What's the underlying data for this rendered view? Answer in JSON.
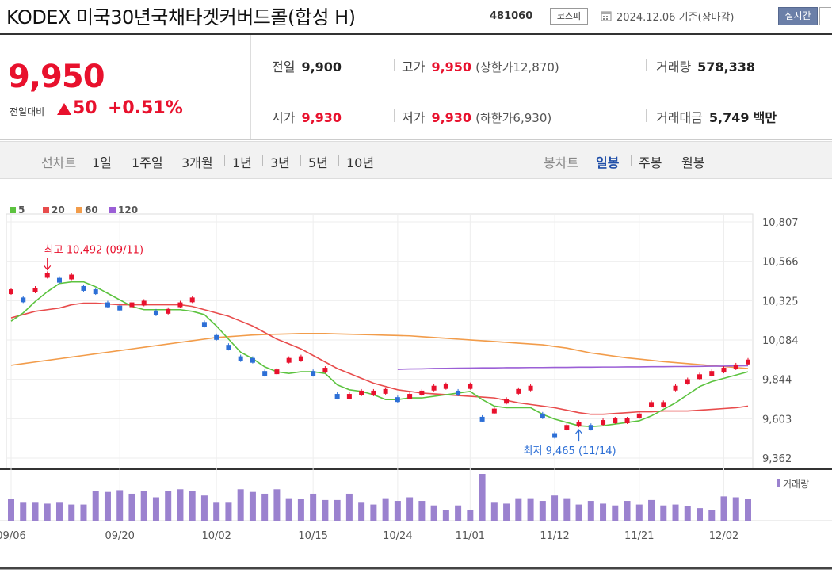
{
  "header": {
    "stock_name": "KODEX 미국30년국채타겟커버드콜(합성 H)",
    "stock_code": "481060",
    "market": "코스피",
    "date_label": "2024.12.06 기준(장마감)",
    "realtime_label": "실시간"
  },
  "summary": {
    "price": "9,950",
    "change_label": "전일대비",
    "change": "50",
    "change_pct": "+0.51%",
    "prev_close_label": "전일",
    "prev_close": "9,900",
    "open_label": "시가",
    "open": "9,930",
    "high_label": "고가",
    "high": "9,950",
    "upper_limit_label": "(상한가",
    "upper_limit": "12,870)",
    "low_label": "저가",
    "low": "9,930",
    "lower_limit_label": "(하한가",
    "lower_limit": "6,930)",
    "volume_label": "거래량",
    "volume": "578,338",
    "amount_label": "거래대금",
    "amount": "5,749",
    "amount_unit": "백만"
  },
  "periods": {
    "line_label": "선차트",
    "line_items": [
      "1일",
      "1주일",
      "3개월",
      "1년",
      "3년",
      "5년",
      "10년"
    ],
    "candle_label": "봉차트",
    "candle_items": [
      "일봉",
      "주봉",
      "월봉"
    ],
    "selected": "일봉"
  },
  "colors": {
    "up": "#e8112d",
    "down": "#2d6fd6",
    "ma5": "#5cc33f",
    "ma20": "#e84c4c",
    "ma60": "#f29c4a",
    "ma120": "#9b5fd6",
    "volume": "#9b82cf"
  },
  "chart_data": {
    "type": "candlestick",
    "legend": [
      {
        "name": "5",
        "color": "#5cc33f"
      },
      {
        "name": "20",
        "color": "#e84c4c"
      },
      {
        "name": "60",
        "color": "#f29c4a"
      },
      {
        "name": "120",
        "color": "#9b5fd6"
      }
    ],
    "y_ticks": [
      "10,807",
      "10,566",
      "10,325",
      "10,084",
      "9,844",
      "9,603",
      "9,362"
    ],
    "ylim": [
      9362,
      10807
    ],
    "x_ticks": [
      "09/06",
      "09/20",
      "10/02",
      "10/15",
      "10/24",
      "11/01",
      "11/12",
      "11/21",
      "12/02"
    ],
    "x_tick_index": [
      0,
      9,
      17,
      25,
      32,
      38,
      45,
      52,
      59
    ],
    "high_annotation": "최고 10,492 (09/11)",
    "high_index": 3,
    "low_annotation": "최저 9,465 (11/14)",
    "low_index": 47,
    "volume_label": "거래량",
    "close": [
      10380,
      10330,
      10390,
      10480,
      10450,
      10470,
      10400,
      10380,
      10300,
      10280,
      10300,
      10310,
      10250,
      10260,
      10300,
      10330,
      10180,
      10100,
      10040,
      9970,
      9960,
      9880,
      9890,
      9960,
      9970,
      9880,
      9900,
      9740,
      9740,
      9760,
      9760,
      9770,
      9720,
      9740,
      9760,
      9790,
      9800,
      9760,
      9800,
      9600,
      9650,
      9710,
      9770,
      9790,
      9620,
      9500,
      9550,
      9570,
      9550,
      9580,
      9590,
      9590,
      9620,
      9690,
      9690,
      9790,
      9830,
      9860,
      9880,
      9900,
      9920,
      9950
    ],
    "ma5": [
      10200,
      10250,
      10320,
      10380,
      10430,
      10440,
      10440,
      10410,
      10370,
      10330,
      10290,
      10270,
      10270,
      10270,
      10270,
      10260,
      10240,
      10170,
      10090,
      10010,
      9970,
      9920,
      9890,
      9880,
      9890,
      9890,
      9880,
      9810,
      9780,
      9770,
      9750,
      9720,
      9720,
      9730,
      9730,
      9740,
      9750,
      9760,
      9770,
      9720,
      9680,
      9670,
      9670,
      9670,
      9630,
      9600,
      9580,
      9560,
      9555,
      9560,
      9570,
      9580,
      9590,
      9620,
      9660,
      9700,
      9750,
      9800,
      9830,
      9850,
      9870,
      9890
    ],
    "ma20": [
      10220,
      10240,
      10260,
      10270,
      10280,
      10300,
      10310,
      10310,
      10305,
      10300,
      10300,
      10300,
      10300,
      10300,
      10300,
      10290,
      10270,
      10250,
      10230,
      10200,
      10170,
      10130,
      10090,
      10060,
      10030,
      9990,
      9950,
      9910,
      9880,
      9850,
      9820,
      9800,
      9780,
      9770,
      9760,
      9755,
      9750,
      9745,
      9740,
      9735,
      9730,
      9715,
      9700,
      9690,
      9680,
      9670,
      9655,
      9640,
      9630,
      9630,
      9635,
      9640,
      9645,
      9645,
      9650,
      9650,
      9650,
      9655,
      9660,
      9665,
      9670,
      9680
    ],
    "ma60": [
      9930,
      9940,
      9950,
      9960,
      9970,
      9980,
      9990,
      10000,
      10010,
      10020,
      10030,
      10040,
      10050,
      10060,
      10070,
      10080,
      10090,
      10100,
      10105,
      10110,
      10115,
      10118,
      10120,
      10122,
      10124,
      10124,
      10124,
      10122,
      10120,
      10118,
      10116,
      10114,
      10112,
      10110,
      10105,
      10100,
      10095,
      10090,
      10085,
      10080,
      10075,
      10070,
      10065,
      10060,
      10055,
      10045,
      10035,
      10020,
      10005,
      9995,
      9985,
      9975,
      9968,
      9960,
      9952,
      9946,
      9940,
      9934,
      9928,
      9922,
      9916,
      9910
    ],
    "ma120": [
      9905,
      9907,
      9908,
      9910,
      9911,
      9912,
      9913,
      9914,
      9914,
      9915,
      9915,
      9916,
      9916,
      9917,
      9917,
      9918,
      9918,
      9919,
      9919,
      9920,
      9920,
      9921,
      9921,
      9922,
      9922,
      9923,
      9924,
      9925,
      9926,
      9927
    ],
    "ma120_start": 32,
    "volume": [
      24,
      20,
      20,
      19,
      20,
      18,
      18,
      33,
      32,
      34,
      30,
      33,
      26,
      33,
      35,
      33,
      28,
      20,
      20,
      35,
      32,
      30,
      35,
      25,
      24,
      30,
      23,
      23,
      30,
      20,
      18,
      25,
      22,
      26,
      22,
      17,
      12,
      17,
      12,
      52,
      20,
      19,
      25,
      25,
      22,
      28,
      25,
      18,
      22,
      19,
      17,
      22,
      18,
      23,
      17,
      18,
      16,
      14,
      12,
      27,
      26,
      24
    ]
  }
}
